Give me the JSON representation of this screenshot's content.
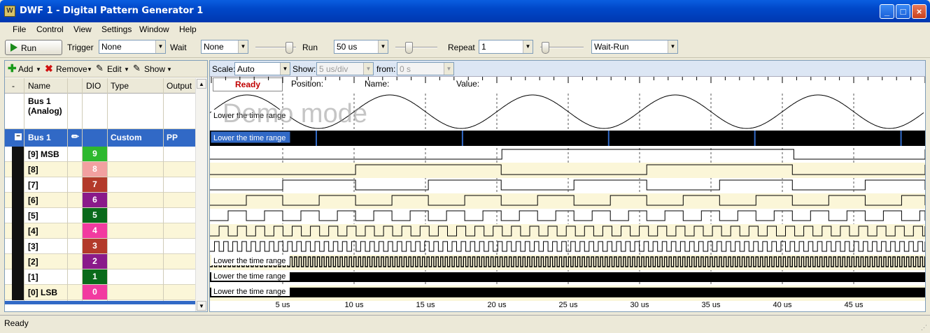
{
  "window": {
    "title": "DWF 1 - Digital Pattern Generator 1",
    "app_icon": "W"
  },
  "menu": [
    "File",
    "Control",
    "View",
    "Settings",
    "Window",
    "Help"
  ],
  "toolbar": {
    "run_label": "Run",
    "trigger_label": "Trigger",
    "trigger_value": "None",
    "wait_label": "Wait",
    "wait_value": "None",
    "run_time_label": "Run",
    "run_time_value": "50 us",
    "repeat_label": "Repeat",
    "repeat_value": "1",
    "mode_value": "Wait-Run"
  },
  "signals_toolbar": {
    "add": "Add",
    "remove": "Remove",
    "edit": "Edit",
    "show": "Show"
  },
  "grid": {
    "headers": {
      "dash": "-",
      "name": "Name",
      "dio": "DIO",
      "type": "Type",
      "output": "Output"
    },
    "analog_row": {
      "name_line1": "Bus 1",
      "name_line2": "(Analog)"
    },
    "bus_row": {
      "expander": "−",
      "name": "Bus 1",
      "type": "Custom",
      "output": "PP"
    },
    "signals": [
      {
        "name": "[9] MSB",
        "dio": "9",
        "color": "#2eb82e"
      },
      {
        "name": "[8]",
        "dio": "8",
        "color": "#f2a0a0"
      },
      {
        "name": "[7]",
        "dio": "7",
        "color": "#b33a2a"
      },
      {
        "name": "[6]",
        "dio": "6",
        "color": "#8a1a8a"
      },
      {
        "name": "[5]",
        "dio": "5",
        "color": "#0a6a1a"
      },
      {
        "name": "[4]",
        "dio": "4",
        "color": "#f23aa0"
      },
      {
        "name": "[3]",
        "dio": "3",
        "color": "#b33a2a"
      },
      {
        "name": "[2]",
        "dio": "2",
        "color": "#8a1a8a"
      },
      {
        "name": "[1]",
        "dio": "1",
        "color": "#0a6a1a"
      },
      {
        "name": "[0] LSB",
        "dio": "0",
        "color": "#f23aa0"
      }
    ]
  },
  "plot": {
    "scale_label": "Scale:",
    "scale_value": "Auto",
    "show_label": "Show:",
    "show_value": "5 us/div",
    "from_label": "from:",
    "from_value": "0 s",
    "status": "Ready",
    "position_label": "Position:",
    "name_label": "Name:",
    "value_label": "Value:",
    "watermark": "Demo mode",
    "hint": "Lower the time range",
    "time_ticks": [
      "5 us",
      "10 us",
      "15 us",
      "20 us",
      "25 us",
      "30 us",
      "35 us",
      "40 us",
      "45 us"
    ]
  },
  "status_bar": "Ready",
  "colors": {
    "selected_row": "#3169c6",
    "row_alt": "#fbf6d8",
    "title": "#0047c8",
    "ready": "#c00000"
  }
}
